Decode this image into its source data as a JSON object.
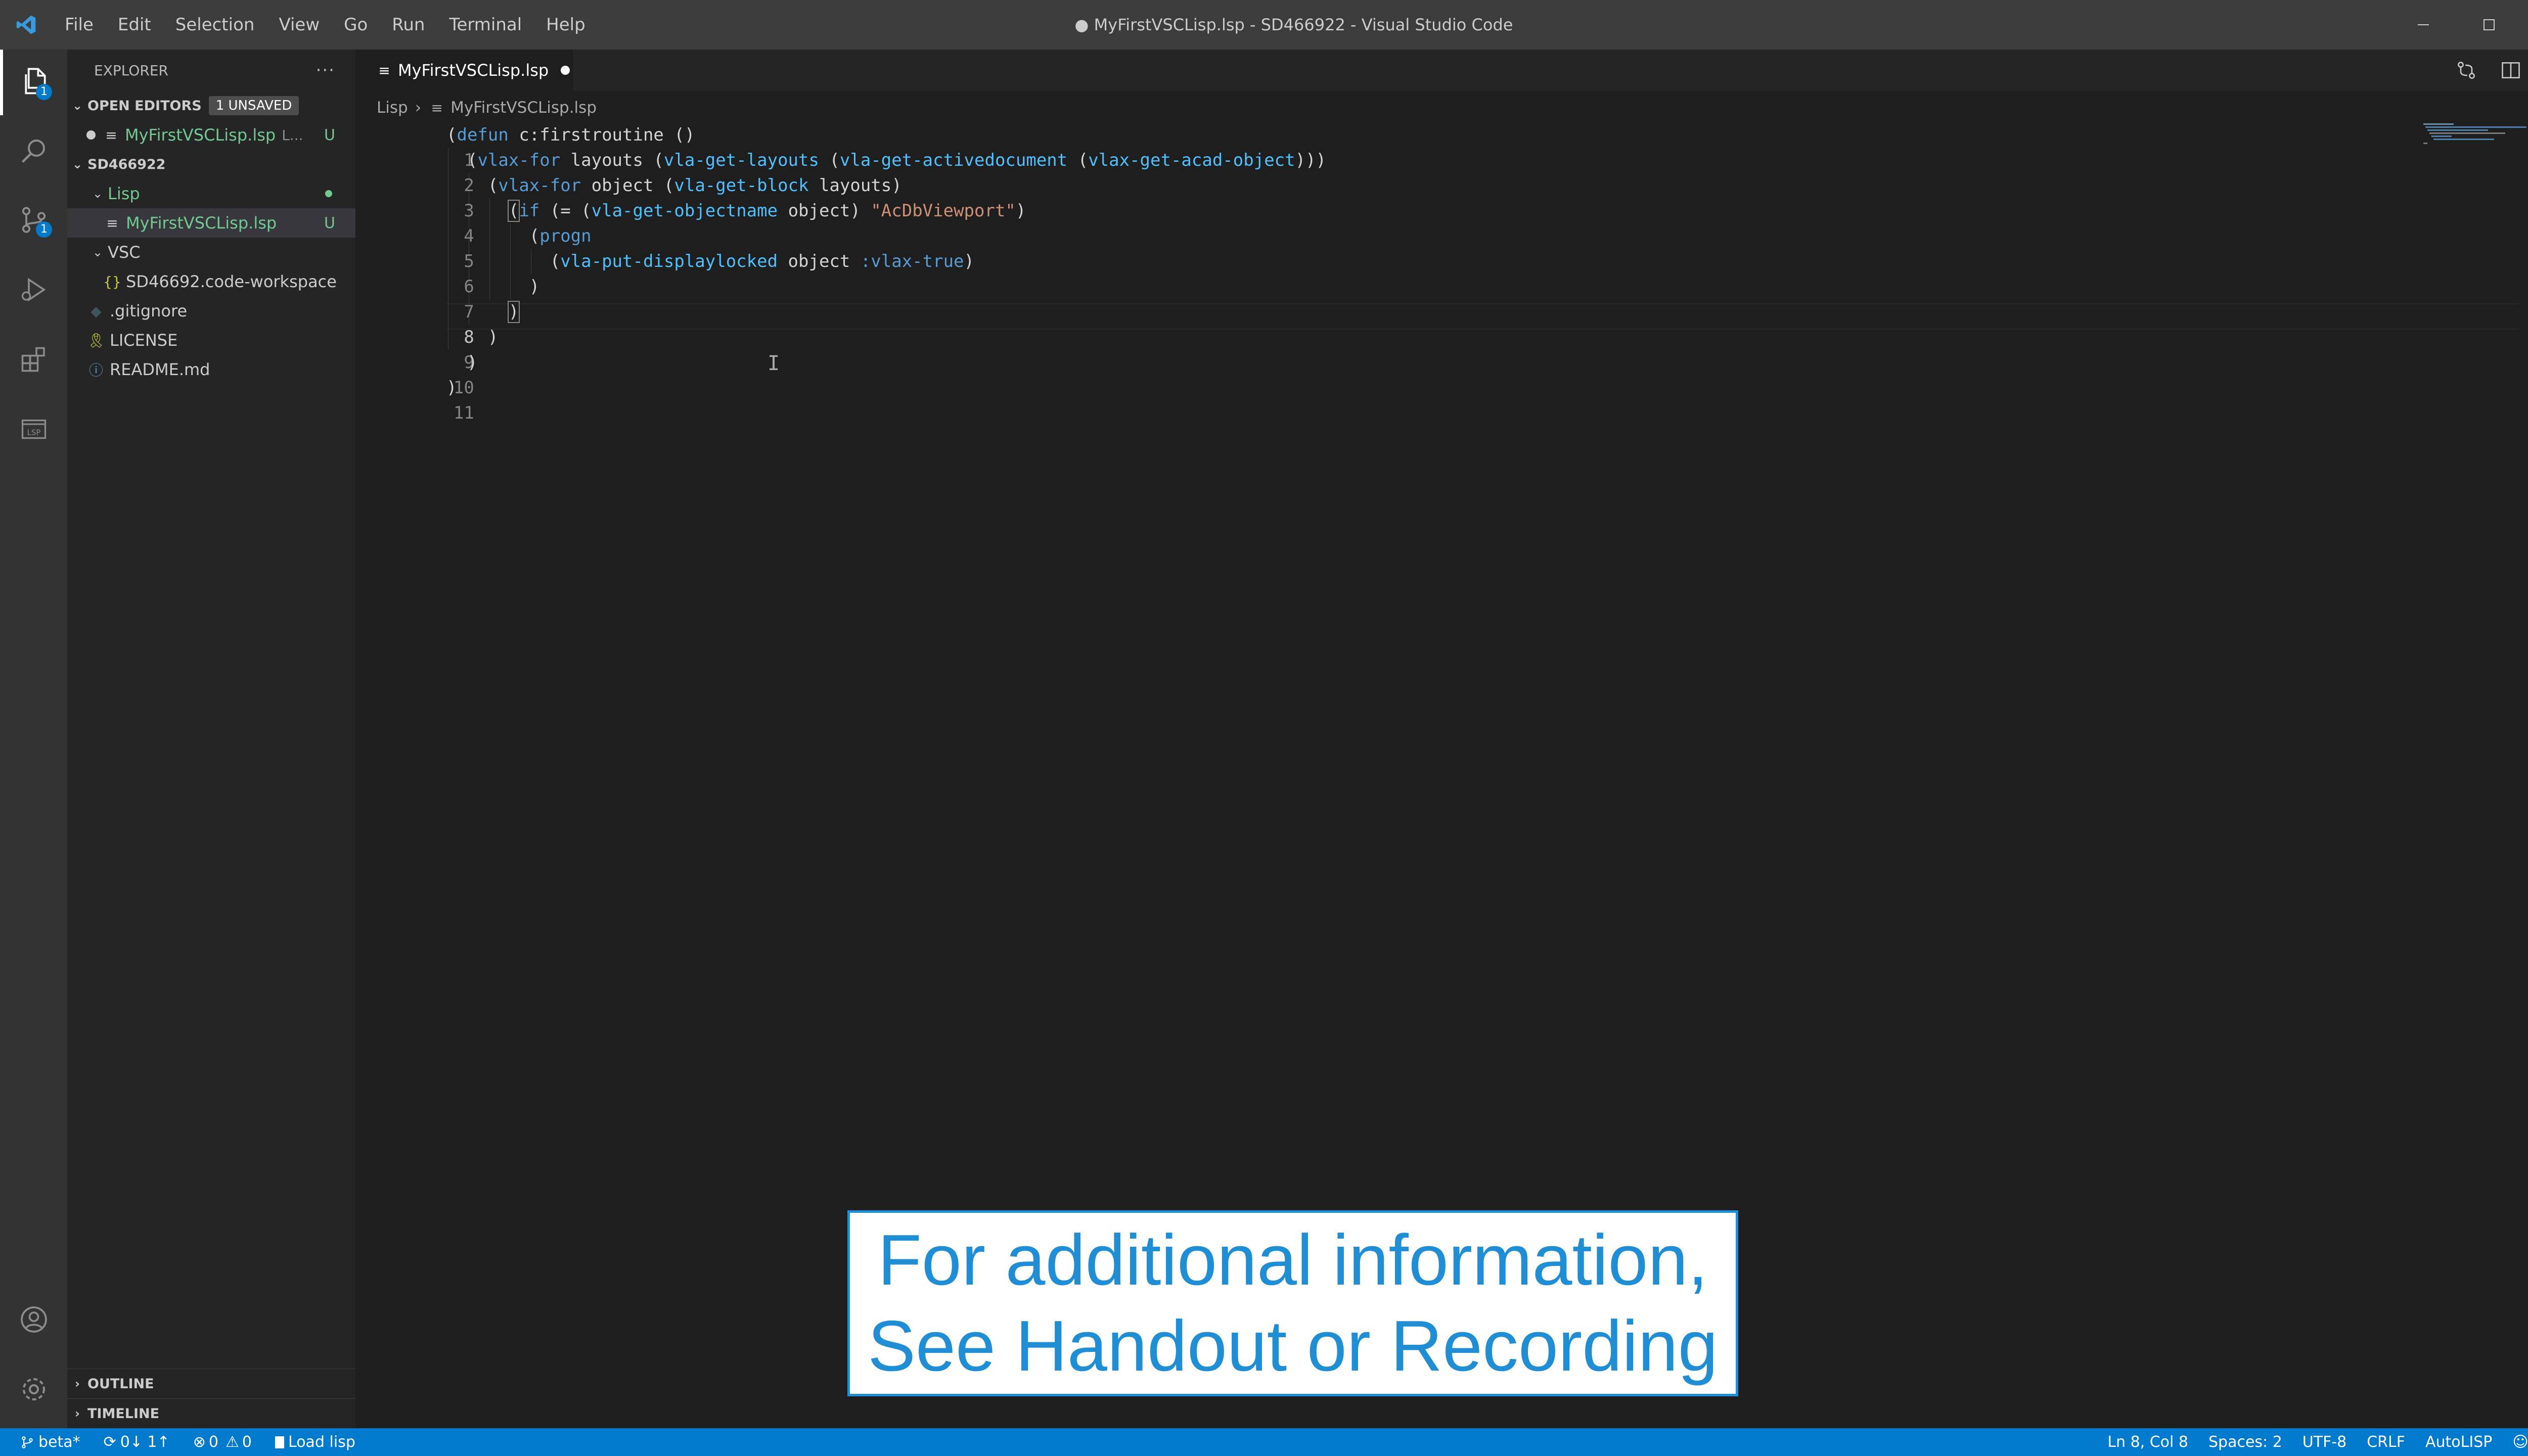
{
  "window": {
    "title": "● MyFirstVSCLisp.lsp - SD466922 - Visual Studio Code",
    "menu": [
      "File",
      "Edit",
      "Selection",
      "View",
      "Go",
      "Run",
      "Terminal",
      "Help"
    ]
  },
  "activity_bar": {
    "explorer_badge": "1",
    "scm_badge": "1",
    "items": [
      "explorer-icon",
      "search-icon",
      "source-control-icon",
      "run-debug-icon",
      "extensions-icon",
      "lsp-icon"
    ],
    "bottom": [
      "account-icon",
      "settings-gear-icon"
    ]
  },
  "sidebar": {
    "title": "EXPLORER",
    "more": "···",
    "open_editors": {
      "label": "OPEN EDITORS",
      "badge": "1 UNSAVED",
      "items": [
        {
          "name": "MyFirstVSCLisp.lsp",
          "path": "L...",
          "status": "U"
        }
      ]
    },
    "workspace": {
      "label": "SD466922",
      "tree": [
        {
          "name": "Lisp",
          "type": "folder"
        },
        {
          "name": "MyFirstVSCLisp.lsp",
          "type": "file",
          "status": "U"
        },
        {
          "name": "VSC",
          "type": "folder"
        },
        {
          "name": "SD46692.code-workspace",
          "type": "file"
        },
        {
          "name": ".gitignore",
          "type": "file"
        },
        {
          "name": "LICENSE",
          "type": "file"
        },
        {
          "name": "README.md",
          "type": "file"
        }
      ]
    },
    "outline_label": "OUTLINE",
    "timeline_label": "TIMELINE"
  },
  "editor": {
    "tab_label": "MyFirstVSCLisp.lsp",
    "breadcrumb": [
      "Lisp",
      "MyFirstVSCLisp.lsp"
    ],
    "line_numbers": [
      "1",
      "2",
      "3",
      "4",
      "5",
      "6",
      "7",
      "8",
      "9",
      "10",
      "11"
    ],
    "code": {
      "l1": {
        "open": "(",
        "kw": "defun",
        "rest": " c:firstroutine ()"
      },
      "l2": {
        "open": "(",
        "kw": "vlax-for",
        "a": " layouts (",
        "f1": "vla-get-layouts",
        "b": " (",
        "f2": "vla-get-activedocument",
        "c": " (",
        "f3": "vlax-get-acad-object",
        "d": ")))"
      },
      "l3": {
        "open": "(",
        "kw": "vlax-for",
        "a": " object (",
        "f1": "vla-get-block",
        "b": " layouts)"
      },
      "l4": {
        "open": "(",
        "kw": "if",
        "a": " (= (",
        "f1": "vla-get-objectname",
        "b": " object) ",
        "s": "\"AcDbViewport\"",
        "c": ")"
      },
      "l5": {
        "open": "(",
        "kw": "progn"
      },
      "l6": {
        "open": "(",
        "f1": "vla-put-displaylocked",
        "a": " object ",
        "sym": ":vlax-true",
        "b": ")"
      },
      "l7": ")",
      "l8": ")",
      "l9": ")",
      "l10": ")",
      "l11": ")"
    }
  },
  "caption": {
    "line1": "For additional information,",
    "line2": "See Handout or Recording"
  },
  "status_bar": {
    "branch": "beta*",
    "sync": "0↓ 1↑",
    "errors": "0",
    "warnings": "0",
    "load": "Load lisp",
    "position": "Ln 8, Col 8",
    "spaces": "Spaces: 2",
    "encoding": "UTF-8",
    "eol": "CRLF",
    "language": "AutoLISP"
  },
  "colors": {
    "accent": "#007acc",
    "caption_text": "#1f8ed4",
    "untracked": "#73c991"
  }
}
